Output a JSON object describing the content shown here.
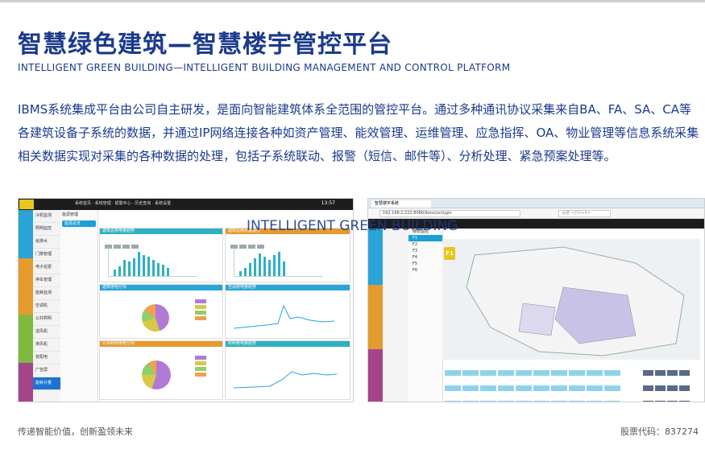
{
  "title": "智慧绿色建筑—智慧楼宇管控平台",
  "subtitle": "INTELLIGENT GREEN BUILDING—INTELLIGENT BUILDING MANAGEMENT AND CONTROL PLATFORM",
  "description": "IBMS系统集成平台由公司自主研发，是面向智能建筑体系全范围的管控平台。通过多种通讯协议采集来自BA、FA、SA、CA等各建筑设备子系统的数据，并通过IP网络连接各种如资产管理、能效管理、运维管理、应急指挥、OA、物业管理等信息系统采集相关数据实现对采集的各种数据的处理，包括子系统联动、报警（短信、邮件等）、分析处理、紧急预案处理等。",
  "watermark": "INTELLIGENT GREEN BUILDING",
  "footer": {
    "slogan": "传递智能价值，创新盈领未来",
    "stock": "股票代码：837274"
  },
  "screenshot1": {
    "clock": "13:57",
    "nav": [
      "冷机监测",
      "照明监控",
      "给排水",
      "门禁管理",
      "电子巡更",
      "停车管理",
      "能耗监测",
      "空调机",
      "公共照明",
      "送风机",
      "排风机",
      "变配电",
      "广告屏",
      "能耗计量"
    ],
    "subnav_head": "能源管理",
    "subnav_pill": "能源总览",
    "panels": [
      {
        "title": "建筑总用电量趋势"
      },
      {
        "title": "建筑总用水量趋势"
      },
      {
        "title": "建筑用电分项"
      },
      {
        "title": "空调用电量趋势"
      },
      {
        "title": "公共照明用电分项"
      },
      {
        "title": "照明用电量趋势"
      }
    ]
  },
  "screenshot2": {
    "tab_title": "智慧楼宇系统",
    "url": "192.168.2.222:8080/ibms/zs/login",
    "search_placeholder": "百度 <Ctrl+K>",
    "panel_title": "楼层监控",
    "floors": [
      "F1",
      "F2",
      "F3",
      "F4",
      "F5",
      "F6"
    ],
    "floor_badge": "F1"
  },
  "colors": {
    "title_blue": "#1b3a8c",
    "accent_teal": "#2fb0c2",
    "badge_yellow": "#e8c61a"
  }
}
